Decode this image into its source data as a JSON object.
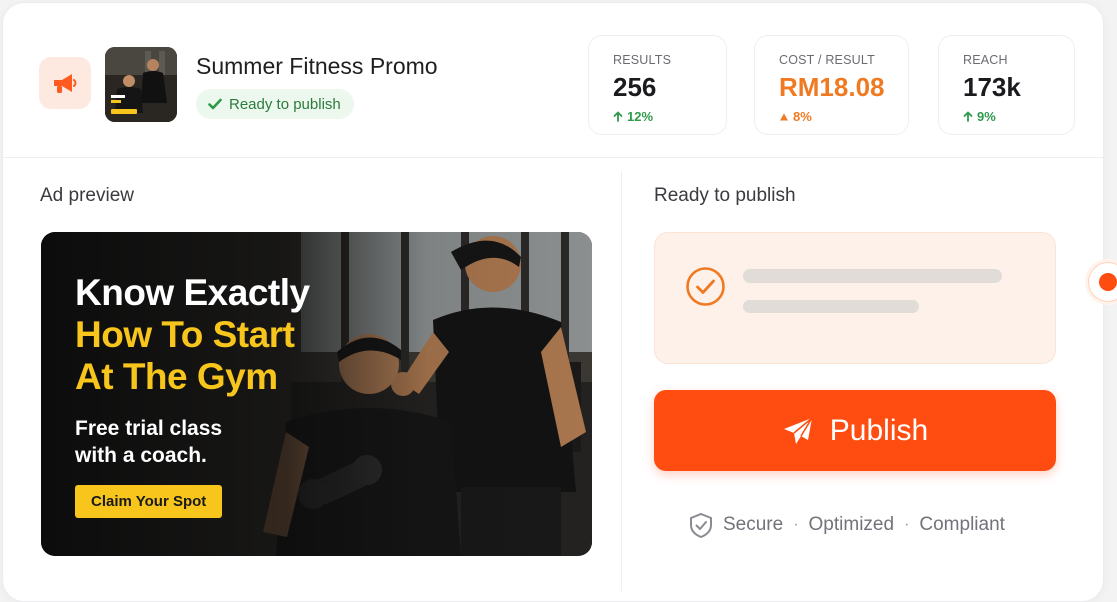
{
  "header": {
    "campaign_title": "Summer Fitness Promo",
    "status": "Ready to publish",
    "stats": [
      {
        "label": "RESULTS",
        "value": "256",
        "change": "12%",
        "trend": "up",
        "color": "#2e9a4c"
      },
      {
        "label": "COST / RESULT",
        "value": "RM18.08",
        "change": "8%",
        "trend": "up",
        "color": "#f07a22"
      },
      {
        "label": "REACH",
        "value": "173k",
        "change": "9%",
        "trend": "up",
        "color": "#2e9a4c"
      }
    ]
  },
  "preview": {
    "title": "Ad preview",
    "headline_line1": "Know Exactly",
    "headline_line2": "How To Start",
    "headline_line3": "At The Gym",
    "subtext_line1": "Free trial class",
    "subtext_line2": "with a coach.",
    "cta": "Claim Your Spot"
  },
  "publish_panel": {
    "title": "Ready to publish",
    "button_label": "Publish",
    "trust_items": [
      "Secure",
      "Optimized",
      "Compliant"
    ],
    "separator": "·"
  },
  "colors": {
    "accent": "#ff4d12",
    "success": "#2e9a4c",
    "warning": "#f07a22",
    "highlight_yellow": "#f7c51c"
  },
  "icons": {
    "header_icon": "megaphone-icon",
    "status_icon": "checkmark-icon",
    "publish_icon": "paper-plane-icon",
    "trust_icon": "shield-check-icon"
  }
}
